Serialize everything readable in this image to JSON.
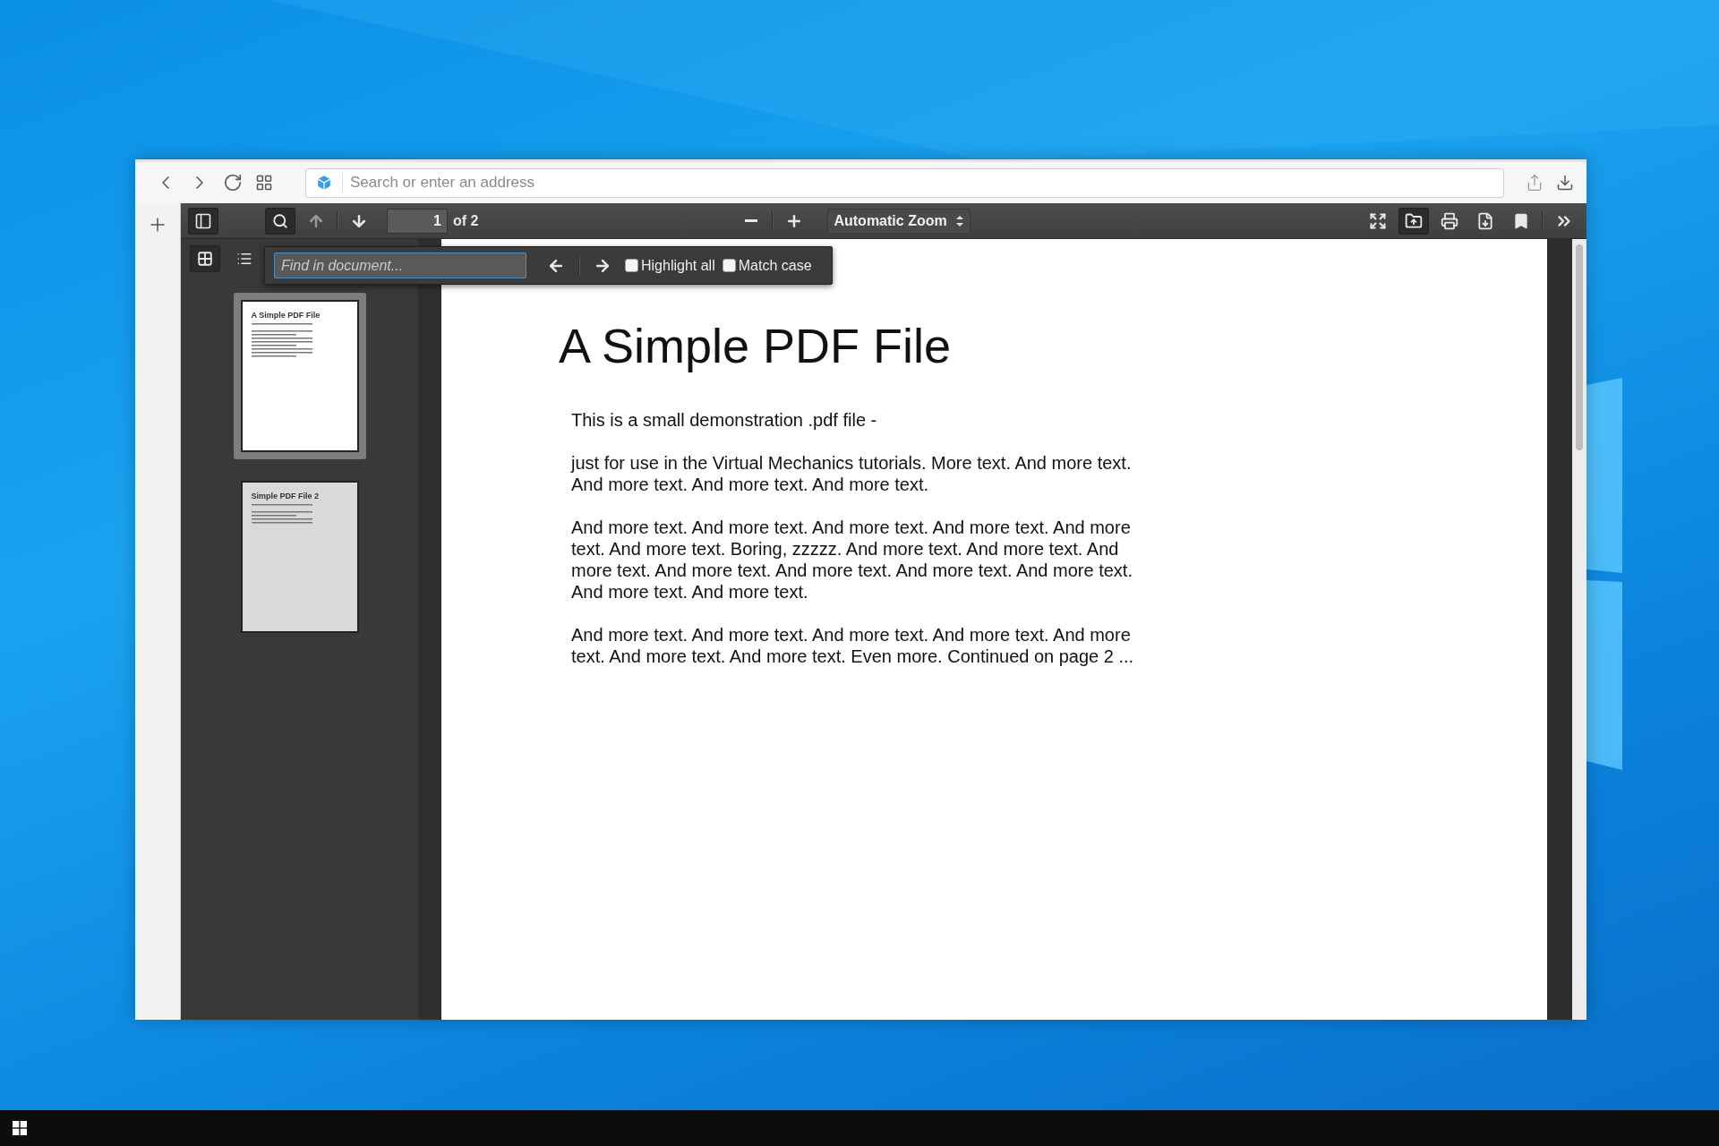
{
  "browser": {
    "address_bar": {
      "placeholder": "Search or enter an address"
    }
  },
  "pdf_toolbar": {
    "page_number": "1",
    "page_count": "of 2",
    "zoom": "Automatic Zoom",
    "find_open": true
  },
  "find_bar": {
    "placeholder": "Find in document...",
    "options": [
      {
        "label": "Highlight all",
        "checked": false
      },
      {
        "label": "Match case",
        "checked": false
      }
    ]
  },
  "sidebar": {
    "views": [
      {
        "kind": "thumbnails",
        "selected": true
      },
      {
        "kind": "outline",
        "selected": false
      }
    ],
    "thumbnails": [
      {
        "title": "A Simple PDF File",
        "selected": true
      },
      {
        "title": "Simple PDF File 2",
        "selected": false
      }
    ]
  },
  "document": {
    "title": "A Simple PDF File",
    "paragraphs": [
      "This is a small demonstration .pdf file -",
      "just for use in the Virtual Mechanics tutorials. More text. And more text. And more text. And more text. And more text.",
      "And more text. And more text. And more text. And more text. And more text. And more text. Boring, zzzzz. And more text. And more text. And more text. And more text. And more text. And more text. And more text. And more text. And more text.",
      "And more text. And more text. And more text. And more text. And more text. And more text. And more text. Even more. Continued on page 2 ..."
    ]
  }
}
